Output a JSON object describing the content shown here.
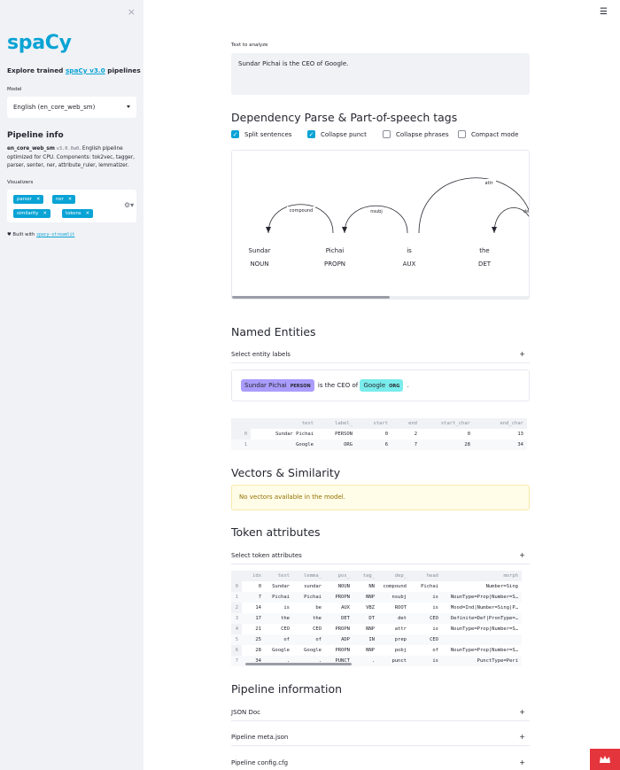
{
  "sidebar": {
    "close_icon": "×",
    "logo": "spaCy",
    "explore_prefix": "Explore trained ",
    "explore_link": "spaCy v3.0",
    "explore_suffix": " pipelines",
    "model_label": "Model",
    "model_value": "English (en_core_web_sm)",
    "pipeline_info_title": "Pipeline info",
    "pipeline_name": "en_core_web_sm",
    "pipeline_version": "v3.0.0a0",
    "pipeline_desc": ". English pipeline optimized for CPU. Components: tok2vec, tagger, parser, senter, ner, attribute_ruler, lemmatizer.",
    "visualizers_label": "Visualizers",
    "visualizers": [
      "parser",
      "ner",
      "similarity",
      "tokens"
    ],
    "built_prefix": "♥ Built with ",
    "built_link": "spacy-streamlit"
  },
  "main": {
    "text_label": "Text to analyze",
    "text_value": "Sundar Pichai is the CEO of Google.",
    "dep_title": "Dependency Parse & Part-of-speech tags",
    "checkboxes": [
      {
        "label": "Split sentences",
        "checked": true
      },
      {
        "label": "Collapse punct",
        "checked": true
      },
      {
        "label": "Collapse phrases",
        "checked": false
      },
      {
        "label": "Compact mode",
        "checked": false
      }
    ],
    "dep_tokens": [
      {
        "text": "Sundar",
        "tag": "NOUN"
      },
      {
        "text": "Pichai",
        "tag": "PROPN"
      },
      {
        "text": "is",
        "tag": "AUX"
      },
      {
        "text": "the",
        "tag": "DET"
      }
    ],
    "dep_arcs": [
      "compound",
      "nsubj",
      "attr",
      "det"
    ],
    "ner_title": "Named Entities",
    "ner_select_label": "Select entity labels",
    "ner_sentence": {
      "ent1_text": "Sundar Pichai",
      "ent1_label": "PERSON",
      "middle": "is the CEO of",
      "ent2_text": "Google",
      "ent2_label": "ORG",
      "end": "."
    },
    "ent_table": {
      "columns": [
        "",
        "text",
        "label_",
        "start",
        "end",
        "start_char",
        "end_char"
      ],
      "rows": [
        [
          "0",
          "Sundar Pichai",
          "PERSON",
          "0",
          "2",
          "0",
          "13"
        ],
        [
          "1",
          "Google",
          "ORG",
          "6",
          "7",
          "28",
          "34"
        ]
      ]
    },
    "vectors_title": "Vectors & Similarity",
    "vectors_warning": "No vectors available in the model.",
    "tokens_title": "Token attributes",
    "tokens_select_label": "Select token attributes",
    "token_table": {
      "columns": [
        "",
        "idx",
        "text",
        "lemma_",
        "pos_",
        "tag_",
        "dep_",
        "head",
        "morph"
      ],
      "rows": [
        [
          "0",
          "0",
          "Sundar",
          "sundar",
          "NOUN",
          "NN",
          "compound",
          "Pichai",
          "Number=Sing"
        ],
        [
          "1",
          "7",
          "Pichai",
          "Pichai",
          "PROPN",
          "NNP",
          "nsubj",
          "is",
          "NounType=Prop|Number=S…"
        ],
        [
          "2",
          "14",
          "is",
          "be",
          "AUX",
          "VBZ",
          "ROOT",
          "is",
          "Mood=Ind|Number=Sing|P…"
        ],
        [
          "3",
          "17",
          "the",
          "the",
          "DET",
          "DT",
          "det",
          "CEO",
          "Definite=Def|PronType=…"
        ],
        [
          "4",
          "21",
          "CEO",
          "CEO",
          "PROPN",
          "NNP",
          "attr",
          "is",
          "NounType=Prop|Number=S…"
        ],
        [
          "5",
          "25",
          "of",
          "of",
          "ADP",
          "IN",
          "prep",
          "CEO",
          ""
        ],
        [
          "6",
          "28",
          "Google",
          "Google",
          "PROPN",
          "NNP",
          "pobj",
          "of",
          "NounType=Prop|Number=S…"
        ],
        [
          "7",
          "34",
          ".",
          ".",
          "PUNCT",
          ".",
          "punct",
          "is",
          "PunctType=Peri"
        ]
      ]
    },
    "pipeline_title": "Pipeline information",
    "pipeline_expanders": [
      "JSON Doc",
      "Pipeline meta.json",
      "Pipeline config.cfg"
    ],
    "plus_icon": "+",
    "hamburger_icon": "☰"
  },
  "colors": {
    "accent": "#09a3d5",
    "person": "#aa9cfc",
    "org": "#7aecec",
    "badge": "#e4353d"
  }
}
